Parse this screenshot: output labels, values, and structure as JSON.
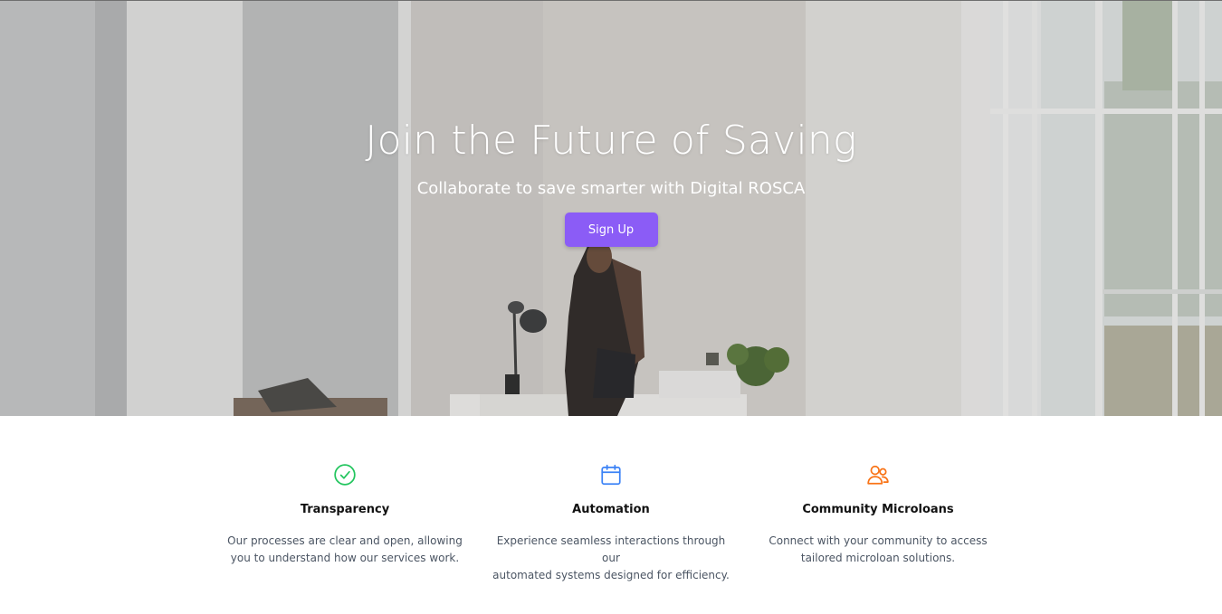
{
  "hero": {
    "title": "Join the Future of Saving",
    "subtitle": "Collaborate to save smarter with Digital ROSCA",
    "cta_label": "Sign Up"
  },
  "features": [
    {
      "icon": "check-circle-icon",
      "color": "#22c55e",
      "title": "Transparency",
      "line1": "Our processes are clear and open, allowing",
      "line2": "you to understand how our services work."
    },
    {
      "icon": "calendar-icon",
      "color": "#3b82f6",
      "title": "Automation",
      "line1": "Experience seamless interactions through our",
      "line2": "automated systems designed for efficiency."
    },
    {
      "icon": "users-icon",
      "color": "#f97316",
      "title": "Community Microloans",
      "line1": "Connect with your community to access",
      "line2": "tailored microloan solutions."
    }
  ],
  "colors": {
    "accent": "#8b5cf6"
  }
}
